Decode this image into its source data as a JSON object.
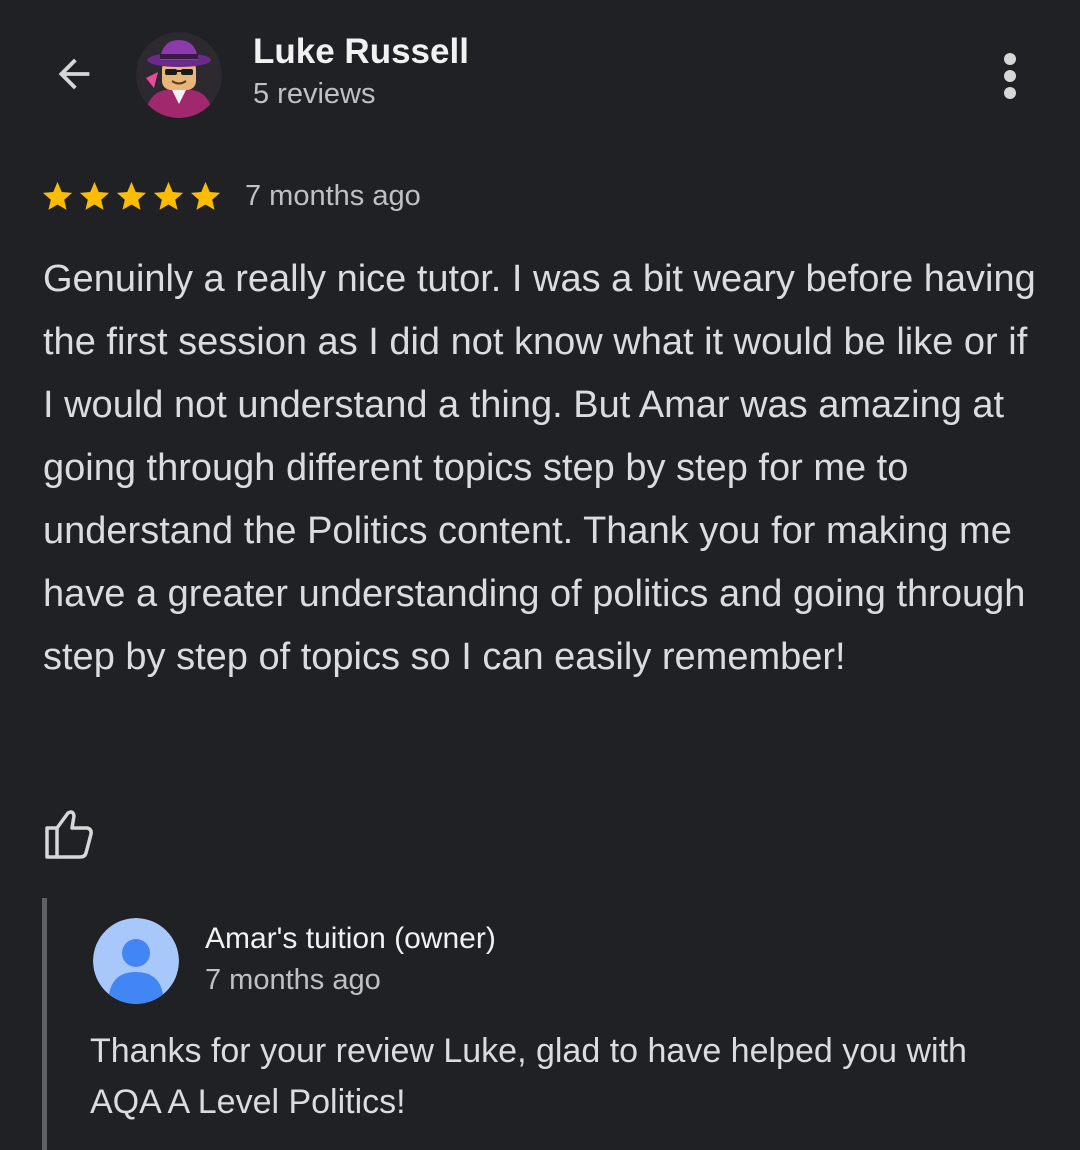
{
  "header": {
    "back_icon": "arrow-left-icon",
    "reviewer_name": "Luke Russell",
    "review_count": "5 reviews",
    "more_icon": "more-vertical-icon"
  },
  "review": {
    "rating": 5,
    "rating_max": 5,
    "time": "7 months ago",
    "text": "Genuinly a really nice tutor. I was a bit weary before having the first session as I did not know what it would be like or if I would not understand a thing. But Amar was amazing at going through different topics step by step for me to understand the Politics content. Thank you for making me have a greater understanding of politics and going through step by step of topics so I can easily remember!",
    "like_icon": "thumbs-up-icon"
  },
  "owner_reply": {
    "name": "Amar's tuition (owner)",
    "time": "7 months ago",
    "text": "Thanks for your review Luke, glad to have helped you with AQA A Level Politics!",
    "avatar_icon": "person-icon"
  },
  "colors": {
    "background": "#202124",
    "star": "#fbbc04",
    "owner_avatar_bg": "#a8c7fa",
    "owner_avatar_fg": "#4285f4"
  }
}
